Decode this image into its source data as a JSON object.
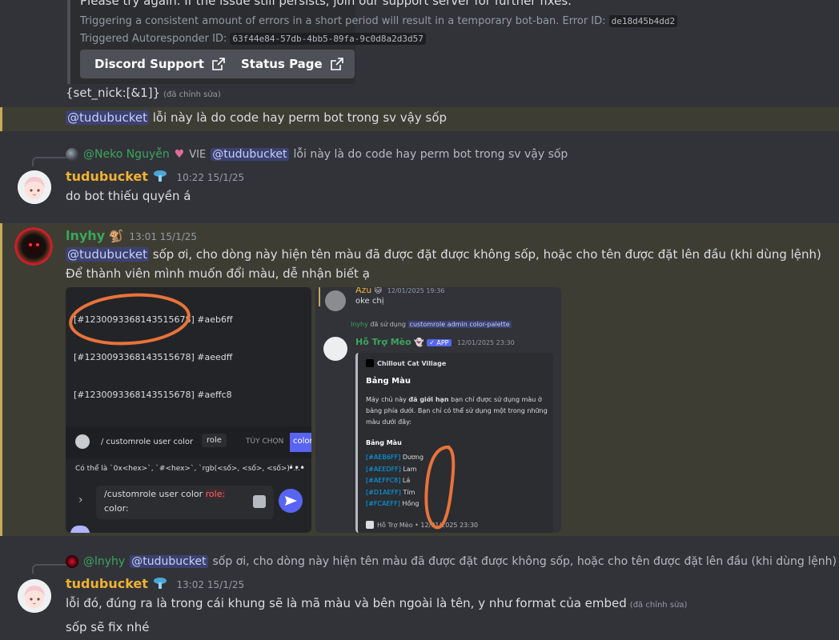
{
  "embed": {
    "line1": "Please try again. If the issue still persists, join our support server for further fixes.",
    "line2_text": "Triggering a consistent amount of errors in a short period will result in a temporary bot-ban. Error ID:",
    "error_id": "de18d45b4dd2",
    "line3_text": "Triggered Autoresponder ID:",
    "autoresponder_id": "63f44e84-57db-4bb5-89fa-9c0d8a2d3d57",
    "btn_support": "Discord Support",
    "btn_status": "Status Page"
  },
  "msg_setnick": {
    "text": "{set_nick:[&1]}",
    "edited": "(đã chỉnh sửa)"
  },
  "msg_highlight1": {
    "mention": "@tudubucket",
    "text": "lỗi này là do code hay perm bot trong sv vậy sốp"
  },
  "reply1": {
    "author": "@Neko Nguyễn",
    "tag": "VIE",
    "mention": "@tudubucket",
    "text": "lỗi này là do code hay perm bot trong sv vậy sốp"
  },
  "msg_tudu1": {
    "author": "tudubucket",
    "time": "10:22 15/1/25",
    "text": "do bot thiếu quyền á"
  },
  "msg_lnyhy": {
    "author": "lnyhy",
    "time": "13:01 15/1/25",
    "mention": "@tudubucket",
    "text1": "sốp ơi, cho dòng này hiện tên màu đã được đặt được không sốp, hoặc cho tên được đặt lên đầu (khi dùng lệnh)",
    "text2": "Để thành viên mình muốn đổi màu, dễ nhận biết ạ"
  },
  "img_left": {
    "rows": [
      "[#1230093368143515678] #aeb6ff",
      "[#1230093368143515678] #aeedff",
      "[#1230093368143515678] #aeffc8"
    ],
    "cmd": "/ customrole user color",
    "opt_role": "role",
    "opt_custom": "TÙY CHỌN",
    "opt_color": "color",
    "hint": "Có thể là `0x<hex>`, `#<hex>`, `rgb(<số>, <số>, <số>)`...",
    "input_line1": "/customrole user color",
    "input_role": "role:",
    "input_line2": "color:"
  },
  "img_right": {
    "azu_name": "Azu",
    "azu_time": "12/01/2025 19:36",
    "azu_text": "oke chị",
    "used_by": "lnyhy",
    "used_text": "đã sử dụng",
    "cmd": "customrole admin color-palette",
    "bot_name": "Hỗ Trợ Mèo",
    "app_badge": "✓ APP",
    "bot_time": "12/01/2025 23:30",
    "server": "Chillout Cat Village",
    "title": "Bảng Màu",
    "desc_pre": "Máy chủ này",
    "desc_bold": "đã giới hạn",
    "desc_post": "bạn chỉ được sử dụng màu ở bảng phía dưới. Bạn chỉ có thể sử dụng một trong những màu dưới đây:",
    "palette_title": "Bảng Màu",
    "palette": [
      {
        "code": "[#AEB6FF]",
        "name": "Dương"
      },
      {
        "code": "[#AEEDFF]",
        "name": "Lam"
      },
      {
        "code": "[#AEFFC8]",
        "name": "Lá"
      },
      {
        "code": "[#D1AEFF]",
        "name": "Tím"
      },
      {
        "code": "[#FCAEFF]",
        "name": "Hồng"
      }
    ],
    "footer": "Hỗ Trợ Mèo • 12/01/2025 23:30"
  },
  "reply2": {
    "author": "@lnyhy",
    "mention": "@tudubucket",
    "text": "sốp ơi, cho dòng này hiện tên màu đã được đặt được không sốp, hoặc cho tên được đặt lên đầu (khi dùng lệnh)"
  },
  "msg_tudu2": {
    "author": "tudubucket",
    "time": "13:02 15/1/25",
    "text1": "lỗi đó, đúng ra là trong cái khung sẽ là mã màu và bên ngoài là tên, y như format của embed",
    "edited": "(đã chỉnh sửa)",
    "text2": "sốp sẽ fix nhé"
  },
  "colors": {
    "mention_bg": "#3c4270",
    "highlight_bg": "#3e3d33",
    "tudu_name": "#f0b232",
    "green_name": "#3ba55c",
    "annotation": "#e8733a"
  }
}
